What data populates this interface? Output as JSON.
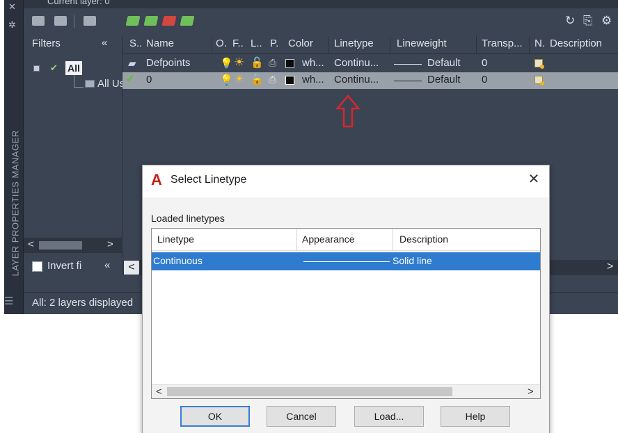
{
  "palette": {
    "current_layer_text": "Current layer: 0",
    "side_title": "LAYER PROPERTIES MANAGER",
    "filters_header": "Filters",
    "collapse_glyph": "«",
    "tree": {
      "root": "All",
      "child": "All Us"
    },
    "invert_filter_label": "Invert fi",
    "status": "All: 2 layers displayed",
    "columns": [
      "S..",
      "Name",
      "O.",
      "F..",
      "L..",
      "P.",
      "Color",
      "Linetype",
      "Lineweight",
      "Transp...",
      "N.",
      "Description"
    ],
    "layers": [
      {
        "name": "Defpoints",
        "color": "wh...",
        "linetype": "Continu...",
        "lineweight": "Default",
        "transparency": "0",
        "status_icon": "layer-icon",
        "selected": false
      },
      {
        "name": "0",
        "color": "wh...",
        "linetype": "Continu...",
        "lineweight": "Default",
        "transparency": "0",
        "status_icon": "current-checkmark-icon",
        "selected": true
      }
    ],
    "scroll_left": "<",
    "scroll_right": ">"
  },
  "dialog": {
    "title": "Select Linetype",
    "logo": "A",
    "close": "✕",
    "loaded_label": "Loaded linetypes",
    "columns": [
      "Linetype",
      "Appearance",
      "Description"
    ],
    "rows": [
      {
        "linetype": "Continuous",
        "description": "Solid line",
        "selected": true
      }
    ],
    "scroll_left": "<",
    "scroll_right": ">",
    "buttons": {
      "ok": "OK",
      "cancel": "Cancel",
      "load": "Load...",
      "help": "Help"
    }
  },
  "colors": {
    "palette_bg": "#3b4453",
    "selected_row": "#9aa0a8",
    "dialog_selection": "#2e7bcf",
    "annotation_arrow": "#d9262c",
    "autocad_logo": "#c8201a"
  }
}
